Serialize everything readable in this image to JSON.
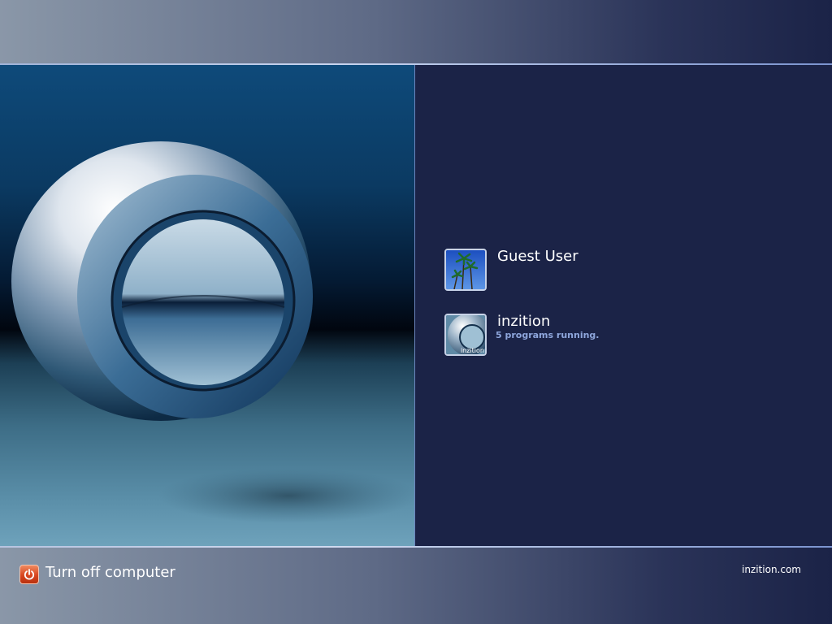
{
  "users": [
    {
      "name": "Guest User",
      "status": "",
      "avatar_icon": "palm-trees-icon"
    },
    {
      "name": "inzition",
      "status": "5 programs running.",
      "avatar_icon": "sphere-avatar-icon",
      "avatar_caption": "inzition"
    }
  ],
  "footer": {
    "turn_off_label": "Turn off computer",
    "power_icon": "power-icon",
    "site": "inzition.com"
  },
  "colors": {
    "panel_bg": "#1b2347",
    "status_text": "#8ea6dc",
    "power_button": "#d8461f"
  }
}
